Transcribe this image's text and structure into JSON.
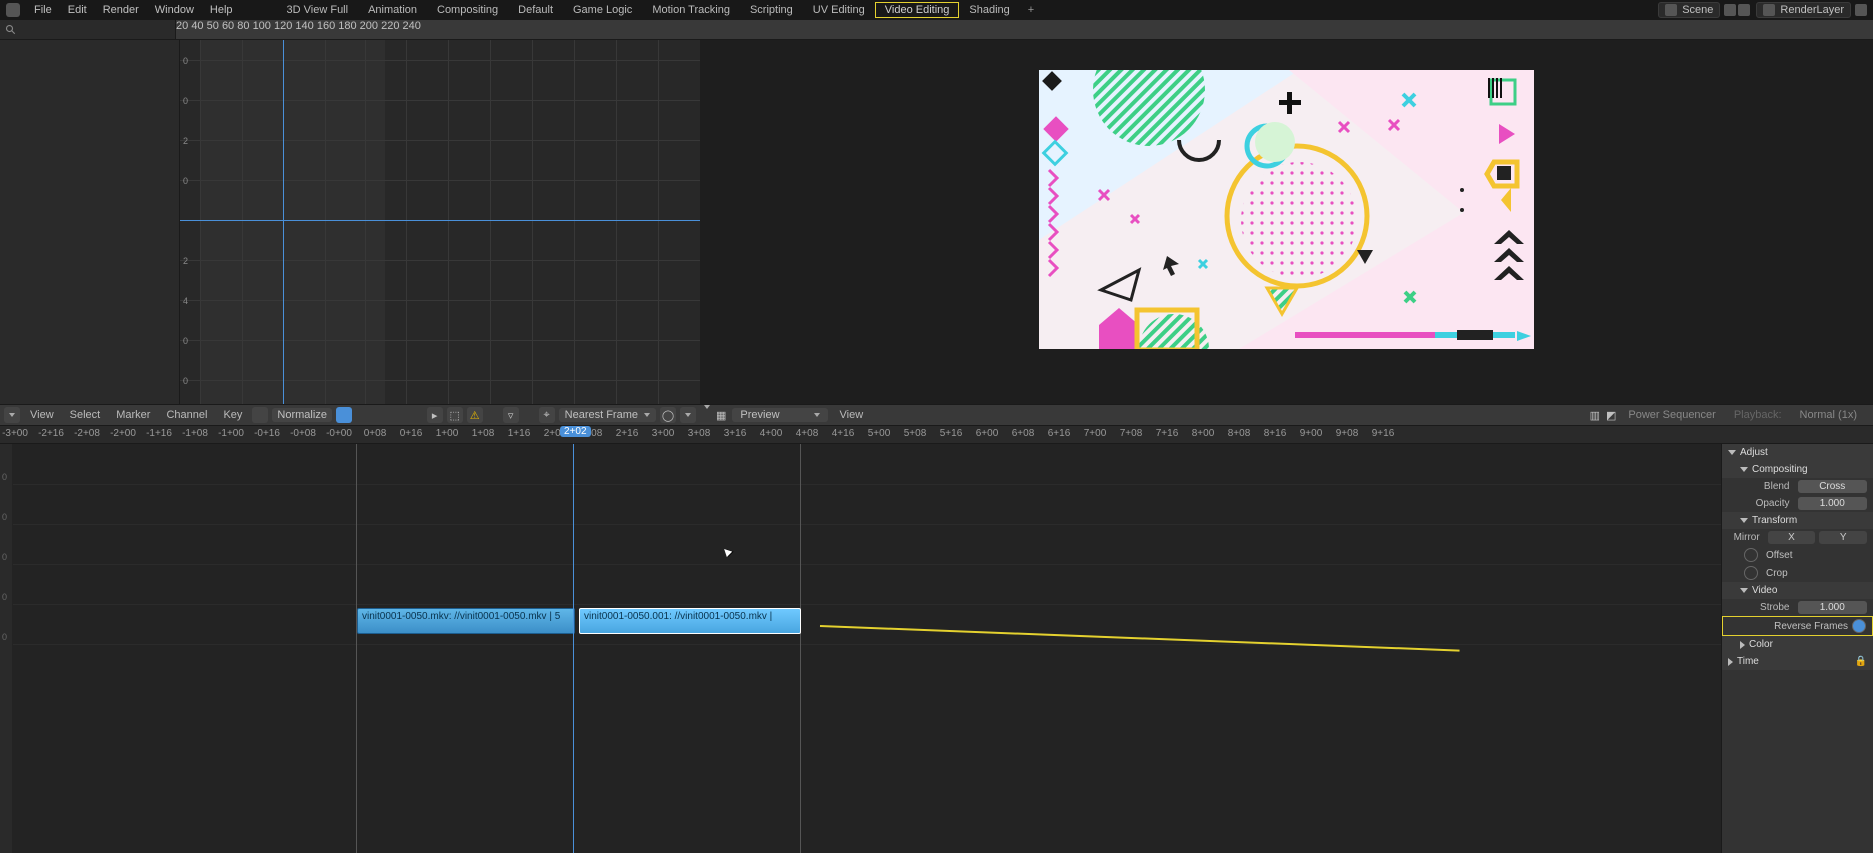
{
  "menu": {
    "file": "File",
    "edit": "Edit",
    "render": "Render",
    "window": "Window",
    "help": "Help"
  },
  "workspaces": [
    "3D View Full",
    "Animation",
    "Compositing",
    "Default",
    "Game Logic",
    "Motion Tracking",
    "Scripting",
    "UV Editing",
    "Video Editing",
    "Shading"
  ],
  "active_workspace": "Video Editing",
  "add_tab": "+",
  "scene": {
    "label": "Scene"
  },
  "render_layer": {
    "label": "RenderLayer"
  },
  "frame_ruler": {
    "ticks": [
      "20",
      "40",
      "60",
      "80",
      "100",
      "120",
      "140",
      "160",
      "180",
      "200",
      "220",
      "240"
    ],
    "current": "50"
  },
  "graph_yticks": [
    "0",
    "0",
    "2",
    "0",
    "2",
    "4",
    "0",
    "0"
  ],
  "graph_header": {
    "view": "View",
    "select": "Select",
    "marker": "Marker",
    "channel": "Channel",
    "key": "Key",
    "normalize": "Normalize",
    "nearest": "Nearest Frame"
  },
  "preview_header": {
    "preview": "Preview",
    "view": "View",
    "power": "Power Sequencer",
    "playback": "Playback:",
    "normal": "Normal (1x)"
  },
  "seq_ruler": {
    "ticks": [
      "-3+00",
      "-2+16",
      "-2+08",
      "-2+00",
      "-1+16",
      "-1+08",
      "-1+00",
      "-0+16",
      "-0+08",
      "-0+00",
      "0+08",
      "0+16",
      "1+00",
      "1+08",
      "1+16",
      "2+00",
      "2+08",
      "2+16",
      "3+00",
      "3+08",
      "3+16",
      "4+00",
      "4+08",
      "4+16",
      "5+00",
      "5+08",
      "5+16",
      "6+00",
      "6+08",
      "6+16",
      "7+00",
      "7+08",
      "7+16",
      "8+00",
      "8+08",
      "8+16",
      "9+00",
      "9+08",
      "9+16"
    ],
    "current": "2+02"
  },
  "strips": [
    {
      "label": "vinit0001-0050.mkv: //vinit0001-0050.mkv | 5"
    },
    {
      "label": "vinit0001-0050.001: //vinit0001-0050.mkv |"
    }
  ],
  "sidebar": {
    "adjust": "Adjust",
    "compositing": "Compositing",
    "blend": "Blend",
    "blend_val": "Cross",
    "opacity": "Opacity",
    "opacity_val": "1.000",
    "transform": "Transform",
    "mirror": "Mirror",
    "mirror_x": "X",
    "mirror_y": "Y",
    "offset": "Offset",
    "crop": "Crop",
    "video": "Video",
    "strobe": "Strobe",
    "strobe_val": "1.000",
    "reverse": "Reverse Frames",
    "color": "Color",
    "time": "Time"
  },
  "channel_nums": [
    "0",
    "0",
    "0",
    "0",
    "0"
  ]
}
